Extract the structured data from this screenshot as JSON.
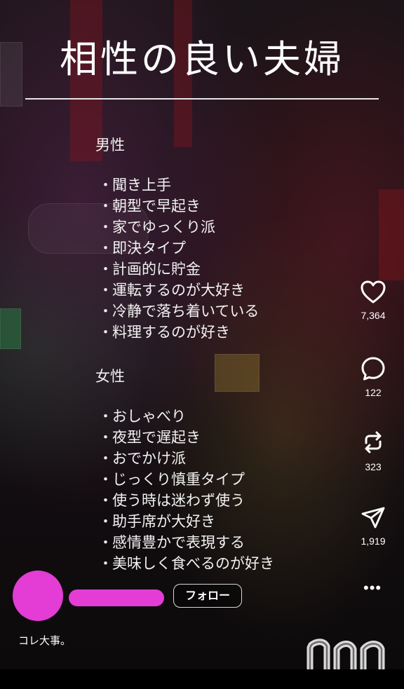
{
  "post": {
    "title": "相性の良い夫婦",
    "sections": [
      {
        "label": "男性",
        "items": [
          "聞き上手",
          "朝型で早起き",
          "家でゆっくり派",
          "即決タイプ",
          "計画的に貯金",
          "運転するのが大好き",
          "冷静で落ち着いている",
          "料理するのが好き"
        ]
      },
      {
        "label": "女性",
        "items": [
          "おしゃべり",
          "夜型で遅起き",
          "おでかけ派",
          "じっくり慎重タイプ",
          "使う時は迷わず使う",
          "助手席が大好き",
          "感情豊かで表現する",
          "美味しく食べるのが好き"
        ]
      }
    ],
    "bullet": "・",
    "caption": "コレ大事。"
  },
  "actions": {
    "like": {
      "icon": "heart-icon",
      "count": "7,364"
    },
    "comment": {
      "icon": "comment-icon",
      "count": "122"
    },
    "repost": {
      "icon": "repost-icon",
      "count": "323"
    },
    "share": {
      "icon": "send-icon",
      "count": "1,919"
    },
    "more": {
      "icon": "more-icon",
      "label": "•••"
    }
  },
  "author": {
    "follow_label": "フォロー",
    "redaction_color": "#e33dd6"
  },
  "watermark": {
    "text": "nn",
    "color": "#ffffff"
  }
}
